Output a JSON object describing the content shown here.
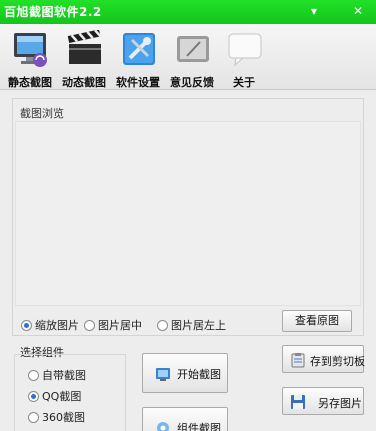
{
  "window": {
    "title": "百旭截图软件2.2",
    "minimize_glyph": "▾",
    "close_glyph": "✕"
  },
  "toolbar": [
    {
      "label": "静态截图",
      "icon": "monitor-icon"
    },
    {
      "label": "动态截图",
      "icon": "clapperboard-icon"
    },
    {
      "label": "软件设置",
      "icon": "settings-tools-icon"
    },
    {
      "label": "意见反馈",
      "icon": "feedback-tablet-icon"
    },
    {
      "label": "关于",
      "icon": "speech-bubble-icon"
    }
  ],
  "preview": {
    "title": "截图浏览",
    "display_options": [
      {
        "label": "缩放图片",
        "selected": true
      },
      {
        "label": "图片居中",
        "selected": false
      },
      {
        "label": "图片居左上",
        "selected": false
      }
    ],
    "view_original_label": "查看原图"
  },
  "components": {
    "title": "选择组件",
    "options": [
      {
        "label": "自带截图",
        "selected": false
      },
      {
        "label": "QQ截图",
        "selected": true
      },
      {
        "label": "360截图",
        "selected": false
      }
    ]
  },
  "actions": {
    "start_capture": "开始截图",
    "component_capture": "组件截图",
    "save_clipboard": "存到剪切板",
    "save_image": "另存图片"
  },
  "colors": {
    "titlebar": "#1cd322",
    "radio_selected": "#2f6fd6"
  }
}
